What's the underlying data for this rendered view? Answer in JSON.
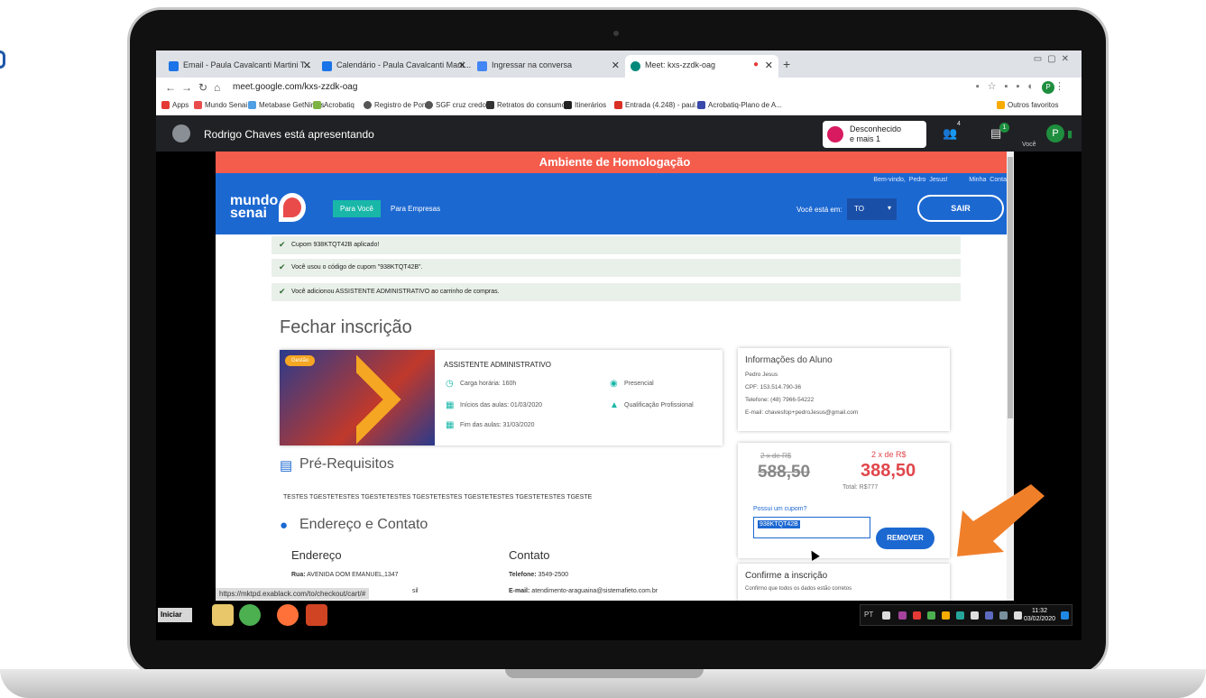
{
  "browser": {
    "tabs": [
      {
        "title": "Email - Paula Cavalcanti Martini T...",
        "icon_color": "#1a73e8"
      },
      {
        "title": "Calendário - Paula Cavalcanti Marti...",
        "icon_color": "#1a73e8"
      },
      {
        "title": "Ingressar na conversa",
        "icon_color": "#4285f4"
      },
      {
        "title": "Meet: kxs-zzdk-oag",
        "icon_color": "#00897b"
      }
    ],
    "url": "meet.google.com/kxs-zzdk-oag",
    "profile_initial": "P",
    "bookmarks": [
      "Apps",
      "Mundo Senai",
      "Metabase GetNinjas",
      "Acrobatiq",
      "Registro de Ponto",
      "SGF cruz credo",
      "Retratos do consumo...",
      "Itinerários",
      "Entrada (4.248) - paul...",
      "Acrobatiq-Plano de A...",
      "Outros favoritos"
    ]
  },
  "meet": {
    "presenter_text": "Rodrigo Chaves está apresentando",
    "unknown_title": "Desconhecido",
    "unknown_sub": "e mais 1",
    "people_count": "4",
    "chat_badge": "1",
    "you_label": "Você",
    "you_initial": "P"
  },
  "site": {
    "env_banner": "Ambiente de Homologação",
    "welcome": "Bem-vindo, Pedro Jesus!",
    "account": "Minha Conta",
    "logo_line1": "mundo",
    "logo_line2": "senai",
    "nav_para_voce": "Para Você",
    "nav_para_empresas": "Para Empresas",
    "state_label": "Você está em:",
    "state_value": "TO",
    "sair": "SAIR",
    "messages": [
      "Cupom 938KTQT42B aplicado!",
      "Você usou o código de cupom \"938KTQT42B\".",
      "Você adicionou ASSISTENTE ADMINISTRATIVO ao carrinho de compras."
    ],
    "page_title": "Fechar inscrição",
    "course": {
      "tag": "Gestão",
      "title": "ASSISTENTE ADMINISTRATIVO",
      "hours": "Carga horária: 160h",
      "start": "Inícios das aulas: 01/03/2020",
      "end": "Fim das aulas: 31/03/2020",
      "mode": "Presencial",
      "type": "Qualificação Profissional"
    },
    "student": {
      "title": "Informações do Aluno",
      "name": "Pedro Jesus",
      "cpf": "CPF: 153.514.790-36",
      "phone": "Telefone: (48) 7966-54222",
      "email": "E-mail: chavesfop+pedroJesus@gmail.com"
    },
    "prereq_title": "Pré-Requisitos",
    "prereq_text": "TESTES TGESTETESTES TGESTETESTES TGESTETESTES TGESTETESTES TGESTETESTES TGESTE",
    "address_title": "Endereço e Contato",
    "price": {
      "old_label": "2 x de R$",
      "old_value": "588,50",
      "new_label": "2 x de R$",
      "new_value": "388,50",
      "total": "Total: R$777",
      "coupon_question": "Possui um cupom?",
      "coupon_value": "938KTQT42B",
      "remove": "REMOVER"
    },
    "endereco_h": "Endereço",
    "contato_h": "Contato",
    "rua_label": "Rua:",
    "rua_value": "AVENIDA DOM EMANUEL,1347",
    "address_partial": "sil",
    "tel_label": "Telefone:",
    "tel_value": "3549-2500",
    "email_label": "E-mail:",
    "email_value": "atendimento-araguaina@sistemafieto.com.br",
    "confirm_title": "Confirme a inscrição",
    "confirm_text": "Confirmo que todos os dados estão corretos",
    "status_url": "https://mktpd.exablack.com/to/checkout/cart/#"
  },
  "taskbar": {
    "start_label": "Iniciar",
    "lang": "PT",
    "time": "11:32",
    "date": "03/02/2020"
  }
}
